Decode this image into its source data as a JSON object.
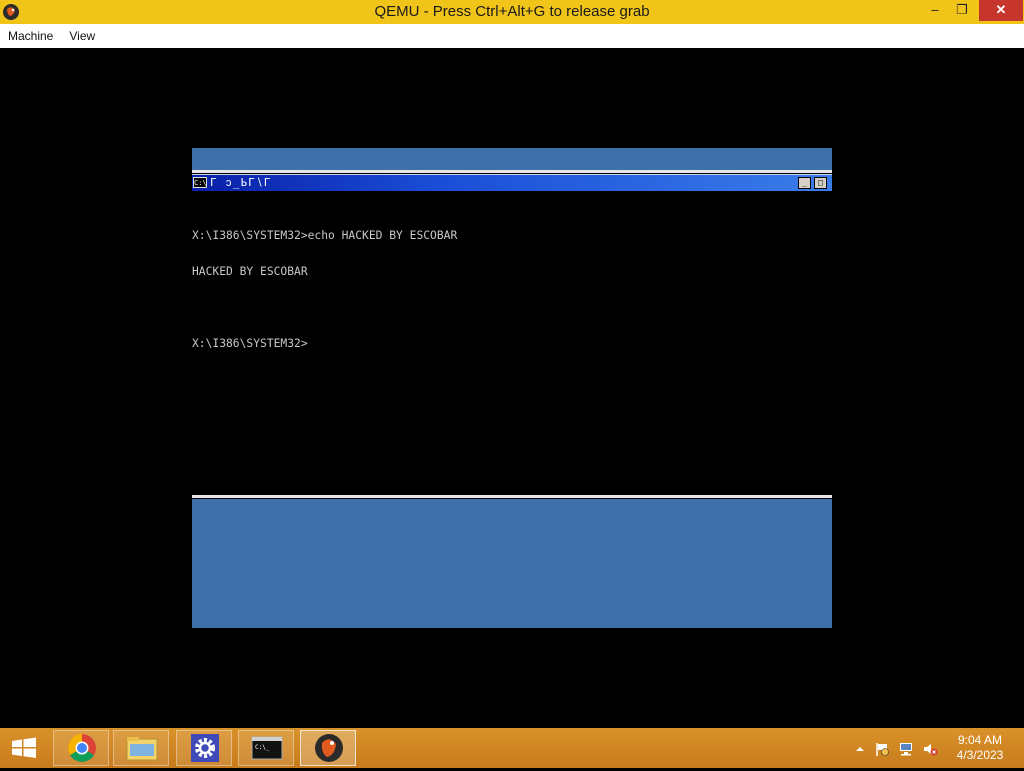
{
  "window": {
    "title": "QEMU - Press Ctrl+Alt+G to release grab",
    "minimize_label": "–",
    "maximize_label": "❐",
    "close_label": "✕"
  },
  "menu": {
    "items": [
      {
        "label": "Machine"
      },
      {
        "label": "View"
      }
    ]
  },
  "console_window": {
    "icon_text": "C:\\",
    "title_glyphs": "Γ ↄ_ЬΓ∖Γ"
  },
  "console": {
    "lines": [
      "X:\\I386\\SYSTEM32>echo HACKED BY ESCOBAR",
      "HACKED BY ESCOBAR",
      "",
      "X:\\I386\\SYSTEM32>"
    ]
  },
  "taskbar": {
    "items": [
      "start-button",
      "chrome",
      "file-explorer",
      "settings",
      "command-prompt",
      "qemu"
    ]
  },
  "tray": {
    "time": "9:04 AM",
    "date": "4/3/2023"
  },
  "colors": {
    "titlebar": "#f0c419",
    "close": "#c7362c",
    "vm_band": "#3e71aa",
    "taskbar": "#d9922a"
  }
}
